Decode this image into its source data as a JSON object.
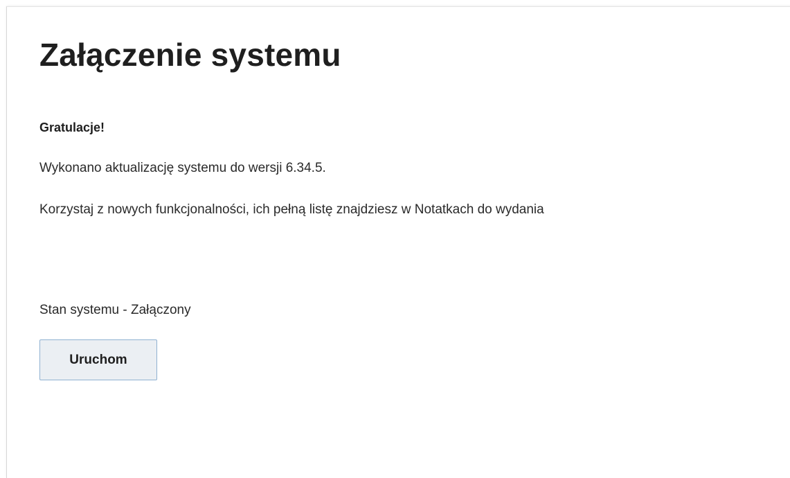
{
  "page": {
    "title": "Załączenie systemu"
  },
  "message": {
    "congrats": "Gratulacje!",
    "version_line": "Wykonano aktualizację systemu do wersji 6.34.5.",
    "features_line": "Korzystaj z nowych funkcjonalności, ich pełną listę znajdziesz w Notatkach do wydania"
  },
  "status": {
    "text": "Stan systemu - Załączony"
  },
  "actions": {
    "run_label": "Uruchom"
  },
  "colors": {
    "button_background": "#ebeff3",
    "button_border": "#8fb1d1",
    "text": "#1f1f1f"
  }
}
